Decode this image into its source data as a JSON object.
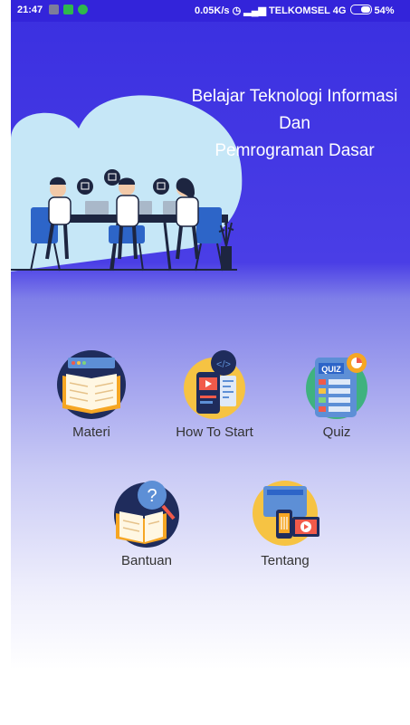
{
  "status_bar": {
    "time": "21:47",
    "network_speed": "0.05K/s",
    "carrier": "TELKOMSEL 4G",
    "battery": "54%"
  },
  "header": {
    "title_line1": "Belajar Teknologi Informasi",
    "title_line2": "Dan",
    "title_line3": "Pemrograman Dasar"
  },
  "menu": {
    "materi": "Materi",
    "how_to_start": "How To Start",
    "quiz": "Quiz",
    "quiz_badge": "QUIZ",
    "bantuan": "Bantuan",
    "tentang": "Tentang"
  },
  "colors": {
    "header_blue": "#3a2fe0",
    "status_bar": "#3324da",
    "text": "#333333"
  }
}
